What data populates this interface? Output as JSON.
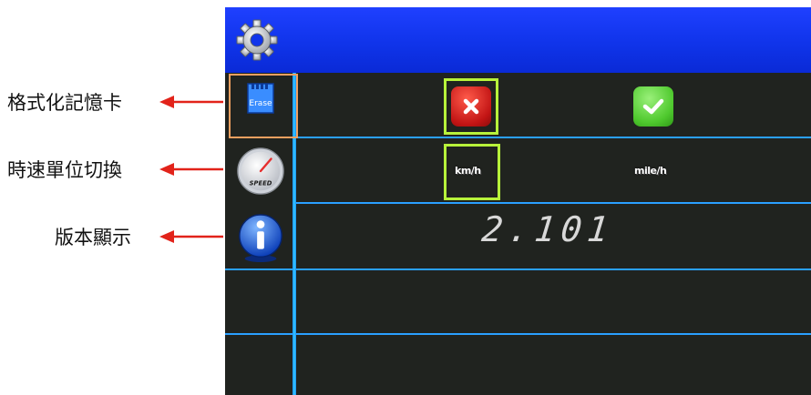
{
  "annotations": [
    {
      "label": "格式化記憶卡"
    },
    {
      "label": "時速單位切換"
    },
    {
      "label": "版本顯示"
    }
  ],
  "settings": {
    "header_icon": "gear-icon",
    "rows": [
      {
        "icon": "sd-card-erase-icon",
        "icon_text": "Erase",
        "cancel_icon": "x-icon",
        "confirm_icon": "check-icon"
      },
      {
        "icon": "speedometer-icon",
        "icon_text": "SPEED",
        "unit_kmh": "km/h",
        "unit_mph": "mile/h",
        "selected_unit": "km/h"
      },
      {
        "icon": "info-icon",
        "version": "2.101"
      }
    ]
  },
  "colors": {
    "header_blue": "#1034ea",
    "screen_bg": "#20231f",
    "grid_line": "#2aa0ff",
    "selection_orange": "#f0a060",
    "selection_green": "#b7f23a",
    "cancel_red": "#d81c1c",
    "confirm_green": "#53d235"
  }
}
